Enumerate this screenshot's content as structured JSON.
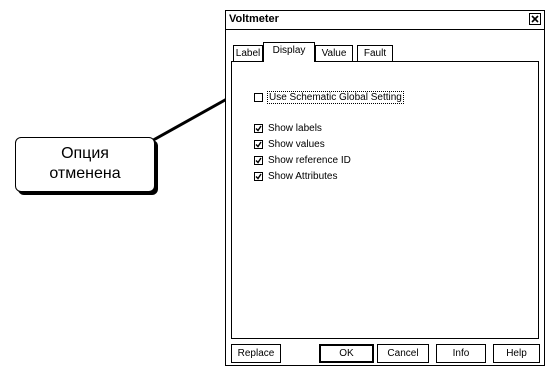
{
  "dialog": {
    "title": "Voltmeter",
    "close_symbol": "✕"
  },
  "tabs": [
    {
      "label": "Label",
      "active": false
    },
    {
      "label": "Display",
      "active": true
    },
    {
      "label": "Value",
      "active": false
    },
    {
      "label": "Fault",
      "active": false
    }
  ],
  "options": {
    "global_setting": {
      "label": "Use Schematic Global Setting",
      "checked": false
    },
    "items": [
      {
        "label": "Show labels",
        "checked": true
      },
      {
        "label": "Show values",
        "checked": true
      },
      {
        "label": "Show reference ID",
        "checked": true
      },
      {
        "label": "Show Attributes",
        "checked": true
      }
    ]
  },
  "buttons": {
    "replace": "Replace",
    "ok": "OK",
    "cancel": "Cancel",
    "info": "Info",
    "help": "Help"
  },
  "callout": {
    "line1": "Опция",
    "line2": "отменена"
  }
}
